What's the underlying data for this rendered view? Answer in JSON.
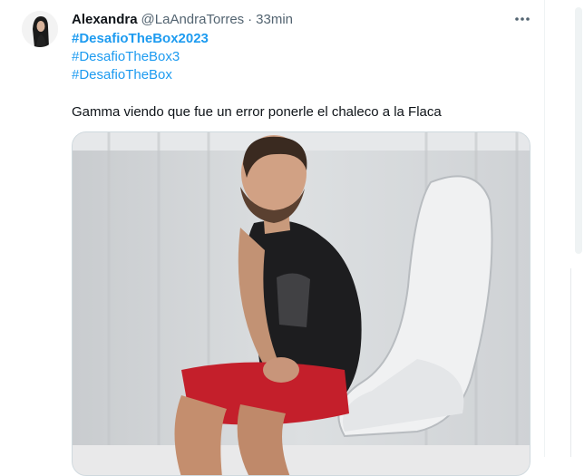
{
  "tweet": {
    "author_name": "Alexandra",
    "handle": "@LaAndraTorres",
    "separator": "·",
    "time": "33min",
    "hashtags": [
      "#DesafioTheBox2023",
      "#DesafioTheBox3",
      "#DesafioTheBox"
    ],
    "text": "Gamma viendo que fue un error ponerle el chaleco a la Flaca"
  },
  "colors": {
    "link": "#1d9bf0",
    "secondary_text": "#536471",
    "primary_text": "#0f1419"
  },
  "icons": {
    "more": "more-horizontal-icon"
  }
}
